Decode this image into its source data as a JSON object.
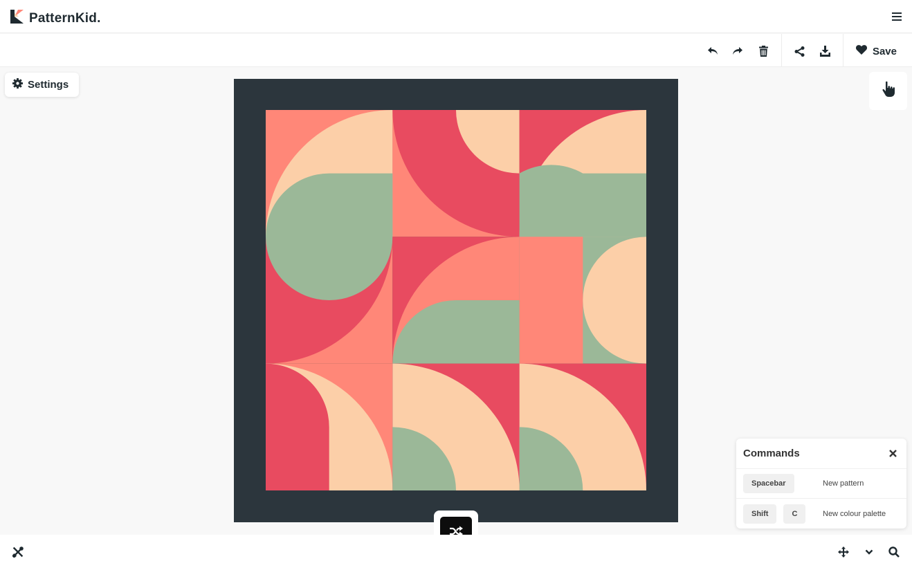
{
  "header": {
    "logo_text": "PatternKid."
  },
  "toolbar": {
    "save_label": "Save"
  },
  "settings": {
    "label": "Settings"
  },
  "commands": {
    "title": "Commands",
    "rows": [
      {
        "keys": [
          "Spacebar"
        ],
        "description": "New pattern"
      },
      {
        "keys": [
          "Shift",
          "C"
        ],
        "description": "New colour palette"
      }
    ]
  },
  "colors": {
    "frame": "#2c363d",
    "coral": "#ff8778",
    "red": "#e84b60",
    "peach": "#fccfa8",
    "sage": "#9bb898"
  },
  "icons": {
    "logo": "patternkid-logo-icon",
    "menu": "hamburger-menu-icon",
    "undo": "undo-icon",
    "redo": "redo-icon",
    "delete": "trash-icon",
    "share": "share-icon",
    "download": "download-icon",
    "save": "heart-icon",
    "settings": "gear-icon",
    "pointer": "hand-pointer-icon",
    "shuffle": "shuffle-icon",
    "close": "close-icon",
    "tools": "tools-icon",
    "move": "move-arrows-icon",
    "chevron": "chevron-down-icon",
    "search": "search-icon"
  }
}
